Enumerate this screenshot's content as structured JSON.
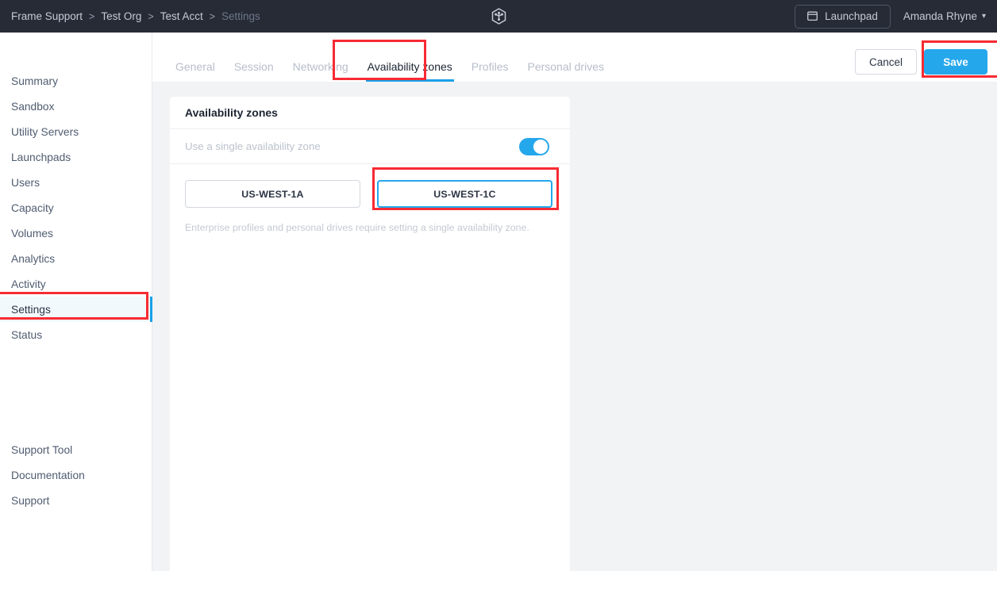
{
  "header": {
    "breadcrumb": [
      {
        "label": "Frame Support",
        "state": "link"
      },
      {
        "label": "Test Org",
        "state": "link"
      },
      {
        "label": "Test Acct",
        "state": "link"
      },
      {
        "label": "Settings",
        "state": "current"
      }
    ],
    "separator": ">",
    "logo_icon": "cube-logo-icon",
    "launchpad": {
      "label": "Launchpad",
      "icon": "window-icon"
    },
    "user": {
      "name": "Amanda Rhyne",
      "caret": "⌄"
    },
    "background_color": "#262b36"
  },
  "sidebar": {
    "top_items": [
      {
        "label": "Summary",
        "active": false
      },
      {
        "label": "Sandbox",
        "active": false
      },
      {
        "label": "Utility Servers",
        "active": false
      },
      {
        "label": "Launchpads",
        "active": false
      },
      {
        "label": "Users",
        "active": false
      },
      {
        "label": "Capacity",
        "active": false
      },
      {
        "label": "Volumes",
        "active": false
      },
      {
        "label": "Analytics",
        "active": false
      },
      {
        "label": "Activity",
        "active": false
      },
      {
        "label": "Settings",
        "active": true
      },
      {
        "label": "Status",
        "active": false
      }
    ],
    "bottom_items": [
      {
        "label": "Support Tool"
      },
      {
        "label": "Documentation"
      },
      {
        "label": "Support"
      }
    ],
    "active_accent_color": "#1aa0e8",
    "active_background_color": "#f2f9fd"
  },
  "tabs": [
    {
      "label": "General",
      "active": false
    },
    {
      "label": "Session",
      "active": false
    },
    {
      "label": "Networking",
      "active": false
    },
    {
      "label": "Availability zones",
      "active": true
    },
    {
      "label": "Profiles",
      "active": false
    },
    {
      "label": "Personal drives",
      "active": false
    }
  ],
  "actions": {
    "cancel_label": "Cancel",
    "save_label": "Save",
    "save_color": "#25a7ec"
  },
  "card": {
    "title": "Availability zones",
    "toggle": {
      "label": "Use a single availability zone",
      "enabled": true,
      "on_color": "#25a7ec"
    },
    "zones": [
      {
        "label": "US-WEST-1A",
        "selected": false
      },
      {
        "label": "US-WEST-1C",
        "selected": true
      }
    ],
    "hint": "Enterprise profiles and personal drives require setting a single availability zone."
  },
  "annotations": {
    "color": "#f72b33",
    "boxes": [
      {
        "name": "settings-sidebar-item"
      },
      {
        "name": "availability-zones-tab"
      },
      {
        "name": "save-button"
      },
      {
        "name": "us-west-1c-zone-button"
      }
    ]
  }
}
